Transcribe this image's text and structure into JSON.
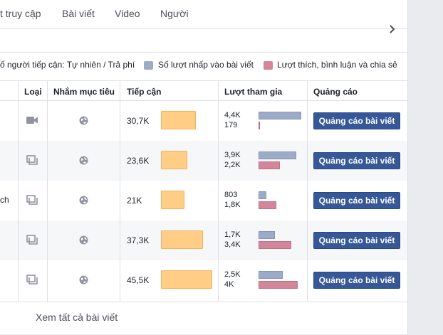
{
  "tabs": [
    "t truy cập",
    "Bài viết",
    "Video",
    "Người"
  ],
  "legend": {
    "reach": "ố người tiếp cận: Tự nhiên / Trả phí",
    "clicks": "Số lượt nhấp vào bài viết",
    "reactions": "Lượt thích, bình luận và chia sẻ",
    "colors": {
      "clicks": "#9cacc8",
      "reactions": "#d3859a",
      "reach": "#ffcd85"
    }
  },
  "table": {
    "headers": [
      "Loại",
      "Nhắm mục tiêu",
      "Tiếp cận",
      "Lượt tham gia",
      "Quảng cáo"
    ],
    "rows": [
      {
        "type": "video-icon",
        "cut": "",
        "reach": "30,7K",
        "reach_value": 30.7,
        "clicks": "4,4K",
        "clicks_value": 4.4,
        "reactions": "179",
        "reactions_value": 0.179,
        "boost": "Quảng cáo bài viết"
      },
      {
        "type": "album-icon",
        "cut": "",
        "reach": "23,6K",
        "reach_value": 23.6,
        "clicks": "3,9K",
        "clicks_value": 3.9,
        "reactions": "2,2K",
        "reactions_value": 2.2,
        "boost": "Quảng cáo bài viết"
      },
      {
        "type": "album-icon",
        "cut": "ch",
        "reach": "21K",
        "reach_value": 21.0,
        "clicks": "803",
        "clicks_value": 0.803,
        "reactions": "1,8K",
        "reactions_value": 1.8,
        "boost": "Quảng cáo bài viết"
      },
      {
        "type": "album-icon",
        "cut": "",
        "reach": "37,3K",
        "reach_value": 37.3,
        "clicks": "1,7K",
        "clicks_value": 1.7,
        "reactions": "3,4K",
        "reactions_value": 3.4,
        "boost": "Quảng cáo bài viết"
      },
      {
        "type": "album-icon",
        "cut": "",
        "reach": "45,5K",
        "reach_value": 45.5,
        "clicks": "2,5K",
        "clicks_value": 2.5,
        "reactions": "4K",
        "reactions_value": 4.0,
        "boost": "Quảng cáo bài viết"
      }
    ]
  },
  "footer": {
    "see_all": "Xem tất cả bài viết"
  }
}
